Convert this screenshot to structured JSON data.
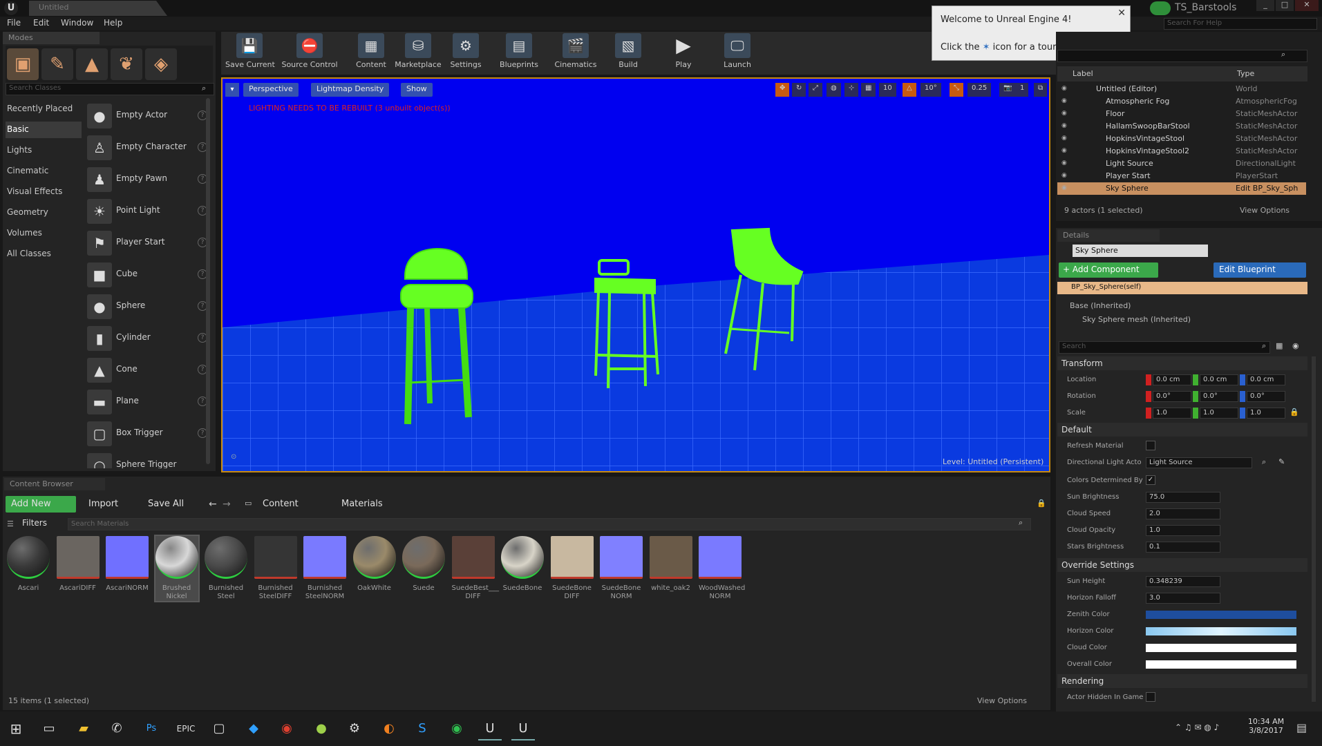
{
  "window": {
    "doc_tab": "Untitled",
    "project": "TS_Barstools",
    "search_help": "Search For Help",
    "minimize": "_",
    "maximize": "□",
    "close": "✕"
  },
  "menu": [
    "File",
    "Edit",
    "Window",
    "Help"
  ],
  "modes": {
    "tab": "Modes",
    "search_placeholder": "Search Classes",
    "categories": [
      "Recently Placed",
      "Basic",
      "Lights",
      "Cinematic",
      "Visual Effects",
      "Geometry",
      "Volumes",
      "All Classes"
    ],
    "selected_category": "Basic",
    "items": [
      "Empty Actor",
      "Empty Character",
      "Empty Pawn",
      "Point Light",
      "Player Start",
      "Cube",
      "Sphere",
      "Cylinder",
      "Cone",
      "Plane",
      "Box Trigger",
      "Sphere Trigger"
    ]
  },
  "toolbar": [
    "Save Current",
    "Source Control",
    "Content",
    "Marketplace",
    "Settings",
    "Blueprints",
    "Cinematics",
    "Build",
    "Play",
    "Launch"
  ],
  "viewport": {
    "perspective": "Perspective",
    "view_mode": "Lightmap Density",
    "show": "Show",
    "warning": "LIGHTING NEEDS TO BE REBUILT (3 unbuilt object(s))",
    "level_label": "Level:",
    "level_name": "Untitled (Persistent)",
    "grid_snap": "10",
    "rot_snap": "10°",
    "scale_snap": "0.25",
    "camera_speed": "1",
    "background": "#0000f0",
    "floor": "#0a3ae0",
    "stool_color": "#66ff22"
  },
  "welcome": {
    "title": "Welcome to Unreal Engine 4!",
    "body": "Click the",
    "body2": "icon for a tour of the tools.",
    "close": "✕"
  },
  "outliner": {
    "col_label": "Label",
    "col_type": "Type",
    "rows": [
      {
        "label": "Untitled (Editor)",
        "type": "World"
      },
      {
        "label": "Atmospheric Fog",
        "type": "AtmosphericFog"
      },
      {
        "label": "Floor",
        "type": "StaticMeshActor"
      },
      {
        "label": "HallamSwoopBarStool",
        "type": "StaticMeshActor"
      },
      {
        "label": "HopkinsVintageStool",
        "type": "StaticMeshActor"
      },
      {
        "label": "HopkinsVintageStool2",
        "type": "StaticMeshActor"
      },
      {
        "label": "Light Source",
        "type": "DirectionalLight"
      },
      {
        "label": "Player Start",
        "type": "PlayerStart"
      },
      {
        "label": "Sky Sphere",
        "type": "Edit BP_Sky_Sph"
      }
    ],
    "status": "9 actors (1 selected)",
    "view_options": "View Options"
  },
  "details": {
    "tab": "Details",
    "name": "Sky Sphere",
    "add_component": "+ Add Component",
    "edit_blueprint": "Edit Blueprint",
    "self": "BP_Sky_Sphere(self)",
    "base": "Base (Inherited)",
    "mesh": "Sky Sphere mesh (Inherited)",
    "search_placeholder": "Search",
    "transform": "Transform",
    "location": "Location",
    "rotation": "Rotation",
    "scale": "Scale",
    "loc_vals": [
      "0.0 cm",
      "0.0 cm",
      "0.0 cm"
    ],
    "rot_vals": [
      "0.0°",
      "0.0°",
      "0.0°"
    ],
    "scale_vals": [
      "1.0",
      "1.0",
      "1.0"
    ],
    "default": "Default",
    "refresh_material": "Refresh Material",
    "dir_light_actor": "Directional Light Acto",
    "dir_light_value": "Light Source",
    "colors_determined": "Colors Determined By",
    "sun_brightness": "Sun Brightness",
    "sun_brightness_val": "75.0",
    "cloud_speed": "Cloud Speed",
    "cloud_speed_val": "2.0",
    "cloud_opacity": "Cloud Opacity",
    "cloud_opacity_val": "1.0",
    "stars_brightness": "Stars Brightness",
    "stars_brightness_val": "0.1",
    "override": "Override Settings",
    "sun_height": "Sun Height",
    "sun_height_val": "0.348239",
    "horizon_falloff": "Horizon Falloff",
    "horizon_falloff_val": "3.0",
    "zenith_color": "Zenith Color",
    "horizon_color": "Horizon Color",
    "cloud_color": "Cloud Color",
    "overall_color": "Overall Color",
    "rendering": "Rendering",
    "actor_hidden": "Actor Hidden In Game",
    "zenith_hex": "#1e4e9e",
    "horizon_hex": "#b8e4ff",
    "cloud_hex": "#ffffff",
    "overall_hex": "#ffffff"
  },
  "content_browser": {
    "tab": "Content Browser",
    "add_new": "Add New",
    "import": "Import",
    "save_all": "Save All",
    "path": [
      "Content",
      "Materials"
    ],
    "filters": "Filters",
    "search_placeholder": "Search Materials",
    "status": "15 items (1 selected)",
    "view_options": "View Options",
    "assets": [
      {
        "name": "Ascari",
        "color": "#3a3a3a",
        "bar": "#2ecc40"
      },
      {
        "name": "AscariDIFF",
        "color": "#6a6560",
        "bar": "#c0392b"
      },
      {
        "name": "AscariNORM",
        "color": "#7070ff",
        "bar": "#c0392b"
      },
      {
        "name": "Brushed\nNickel",
        "color": "#d8d8d8",
        "bar": "#2ecc40"
      },
      {
        "name": "Burnished\nSteel",
        "color": "#4a4a4a",
        "bar": "#2ecc40"
      },
      {
        "name": "Burnished\nSteelDIFF",
        "color": "#353535",
        "bar": "#c0392b"
      },
      {
        "name": "Burnished\nSteelNORM",
        "color": "#7a7aff",
        "bar": "#c0392b"
      },
      {
        "name": "OakWhite",
        "color": "#9a8a6a",
        "bar": "#2ecc40"
      },
      {
        "name": "Suede",
        "color": "#7a6a5a",
        "bar": "#2ecc40"
      },
      {
        "name": "SuedeBest___\nDIFF",
        "color": "#5a4038",
        "bar": "#c0392b"
      },
      {
        "name": "SuedeBone",
        "color": "#d8d4c8",
        "bar": "#2ecc40"
      },
      {
        "name": "SuedeBone\nDIFF",
        "color": "#c8b8a0",
        "bar": "#c0392b"
      },
      {
        "name": "SuedeBone\nNORM",
        "color": "#8080ff",
        "bar": "#c0392b"
      },
      {
        "name": "white_oak2",
        "color": "#6a5a48",
        "bar": "#c0392b"
      },
      {
        "name": "WoodWashed\nNORM",
        "color": "#7a7aff",
        "bar": "#c0392b"
      }
    ]
  },
  "taskbar": {
    "time": "10:34 AM",
    "date": "3/8/2017"
  }
}
